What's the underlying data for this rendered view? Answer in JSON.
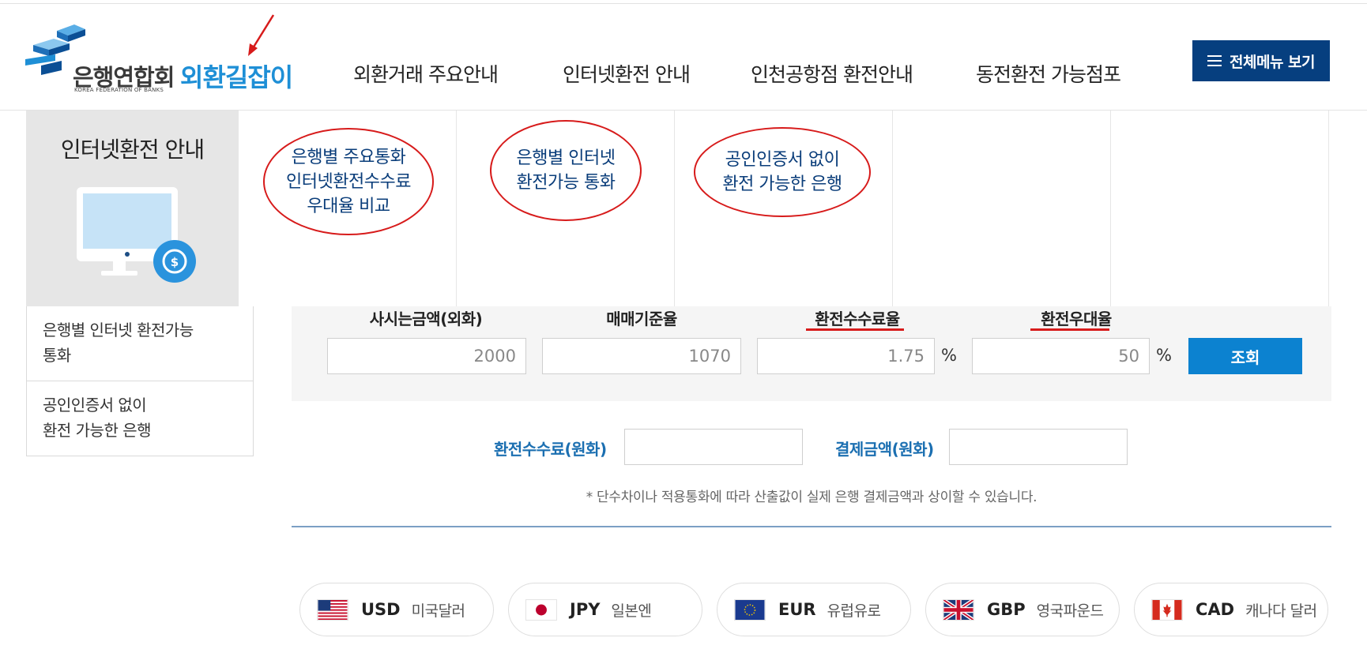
{
  "header": {
    "logo_korean": "은행연합회",
    "logo_english": "KOREA FEDERATION OF BANKS",
    "logo_service": "외환길잡이",
    "nav": [
      {
        "label": "외환거래 주요안내"
      },
      {
        "label": "인터넷환전 안내"
      },
      {
        "label": "인천공항점 환전안내"
      },
      {
        "label": "동전환전 가능점포"
      }
    ],
    "all_menu_label": "전체메뉴 보기"
  },
  "sub_visual": {
    "title": "인터넷환전 안내",
    "annotated_tabs": [
      {
        "label": "은행별 주요통화\n인터넷환전수수료\n우대율 비교"
      },
      {
        "label": "은행별 인터넷\n환전가능 통화"
      },
      {
        "label": "공인인증서 없이\n환전 가능한 은행"
      }
    ]
  },
  "sidebar": {
    "items": [
      {
        "label": "은행별 인터넷 환전가능\n통화"
      },
      {
        "label": "공인인증서 없이\n환전 가능한 은행"
      }
    ]
  },
  "calculator": {
    "fields": [
      {
        "label": "사시는금액(외화)",
        "value": "2000"
      },
      {
        "label": "매매기준율",
        "value": "1070"
      },
      {
        "label": "환전수수료율",
        "value": "1.75",
        "unit": "%"
      },
      {
        "label": "환전우대율",
        "value": "50",
        "unit": "%"
      }
    ],
    "search_label": "조회",
    "result_fee_label": "환전수수료(원화)",
    "result_fee_value": "",
    "result_total_label": "결제금액(원화)",
    "result_total_value": "",
    "note": "* 단수차이나 적용통화에 따라 산출값이 실제 은행 결제금액과 상이할 수 있습니다."
  },
  "currencies": [
    {
      "code": "USD",
      "name": "미국달러",
      "icon": "us-flag-icon"
    },
    {
      "code": "JPY",
      "name": "일본엔",
      "icon": "japan-flag-icon"
    },
    {
      "code": "EUR",
      "name": "유럽유로",
      "icon": "eu-flag-icon"
    },
    {
      "code": "GBP",
      "name": "영국파운드",
      "icon": "uk-flag-icon"
    },
    {
      "code": "CAD",
      "name": "캐나다 달러",
      "icon": "canada-flag-icon"
    }
  ],
  "colors": {
    "brand_navy": "#063f7f",
    "brand_blue": "#1e8fd6",
    "button_blue": "#0c82d0",
    "annotation_red": "#d71b1b"
  }
}
